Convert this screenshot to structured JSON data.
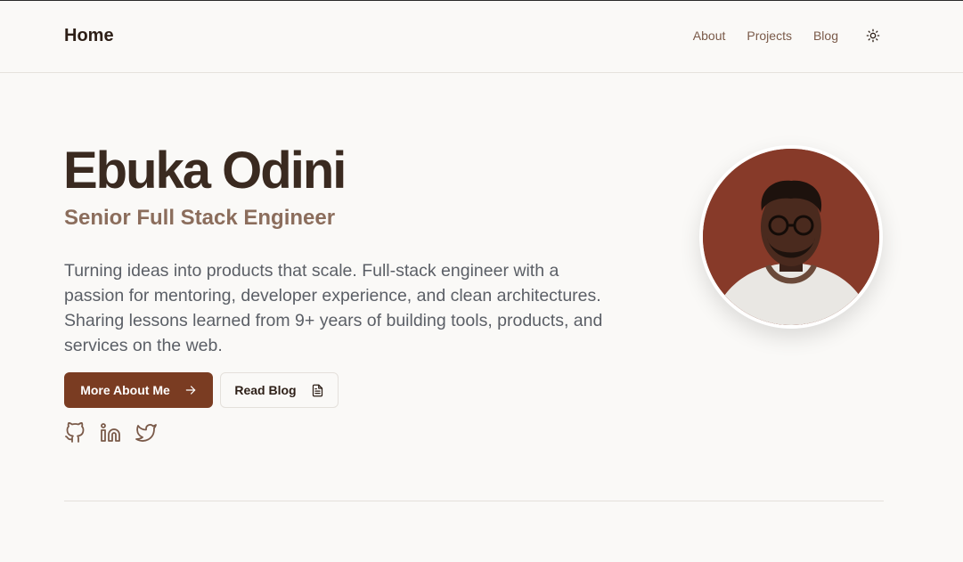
{
  "header": {
    "brand": "Home",
    "nav": [
      {
        "label": "About"
      },
      {
        "label": "Projects"
      },
      {
        "label": "Blog"
      }
    ],
    "theme_icon": "sun-icon"
  },
  "hero": {
    "name": "Ebuka Odini",
    "role": "Senior Full Stack Engineer",
    "bio": "Turning ideas into products that scale. Full-stack engineer with a passion for mentoring, developer experience, and clean architectures. Sharing lessons learned from 9+ years of building tools, products, and services on the web.",
    "primary_button": {
      "label": "More About Me",
      "icon": "arrow-right-icon"
    },
    "secondary_button": {
      "label": "Read Blog",
      "icon": "document-icon"
    },
    "socials": [
      {
        "icon": "github-icon"
      },
      {
        "icon": "linkedin-icon"
      },
      {
        "icon": "twitter-icon"
      }
    ]
  },
  "colors": {
    "background": "#faf9f7",
    "accent": "#7a3c22",
    "heading": "#3a2a20",
    "subheading": "#8b6d5c",
    "body_text": "#5b5f66",
    "avatar_background": "#873a29"
  }
}
